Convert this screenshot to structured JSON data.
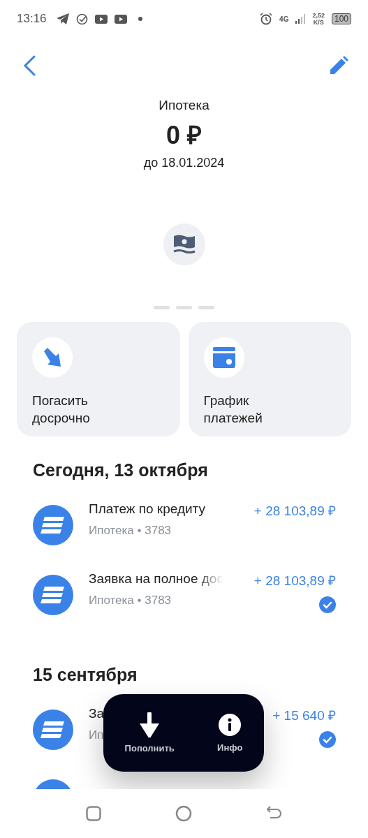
{
  "status_bar": {
    "time": "13:16",
    "network": "4G",
    "speed": "2,52",
    "speed_unit": "K/S",
    "battery": "100"
  },
  "account": {
    "title": "Ипотека",
    "amount": "0 ₽",
    "due": "до 18.01.2024"
  },
  "pager": [
    {
      "selected": false
    },
    {
      "selected": false
    },
    {
      "selected": false
    }
  ],
  "actions": [
    {
      "kind": "repay",
      "label": "Погасить досрочно"
    },
    {
      "kind": "schedule",
      "label": "График платежей"
    }
  ],
  "sections": [
    {
      "heading": "Сегодня, 13 октября",
      "rows": [
        {
          "kind": "full",
          "title": "Платеж по кредиту",
          "subtitle": "Ипотека • 3783",
          "amount": "+ 28 103,89 ₽",
          "confirmed": false,
          "faded": false
        },
        {
          "kind": "full",
          "title": "Заявка на полное дос",
          "subtitle": "Ипотека • 3783",
          "amount": "+ 28 103,89 ₽",
          "confirmed": true,
          "faded": true
        }
      ]
    },
    {
      "heading": "15 сентября",
      "rows": [
        {
          "kind": "full",
          "title": "За",
          "subtitle": "Ип",
          "amount": "+ 15 640 ₽",
          "confirmed": true,
          "faded": false
        },
        {
          "kind": "partial"
        }
      ]
    }
  ],
  "popup": [
    {
      "kind": "topup",
      "label": "Пополнить"
    },
    {
      "kind": "info",
      "label": "Инфо"
    }
  ]
}
